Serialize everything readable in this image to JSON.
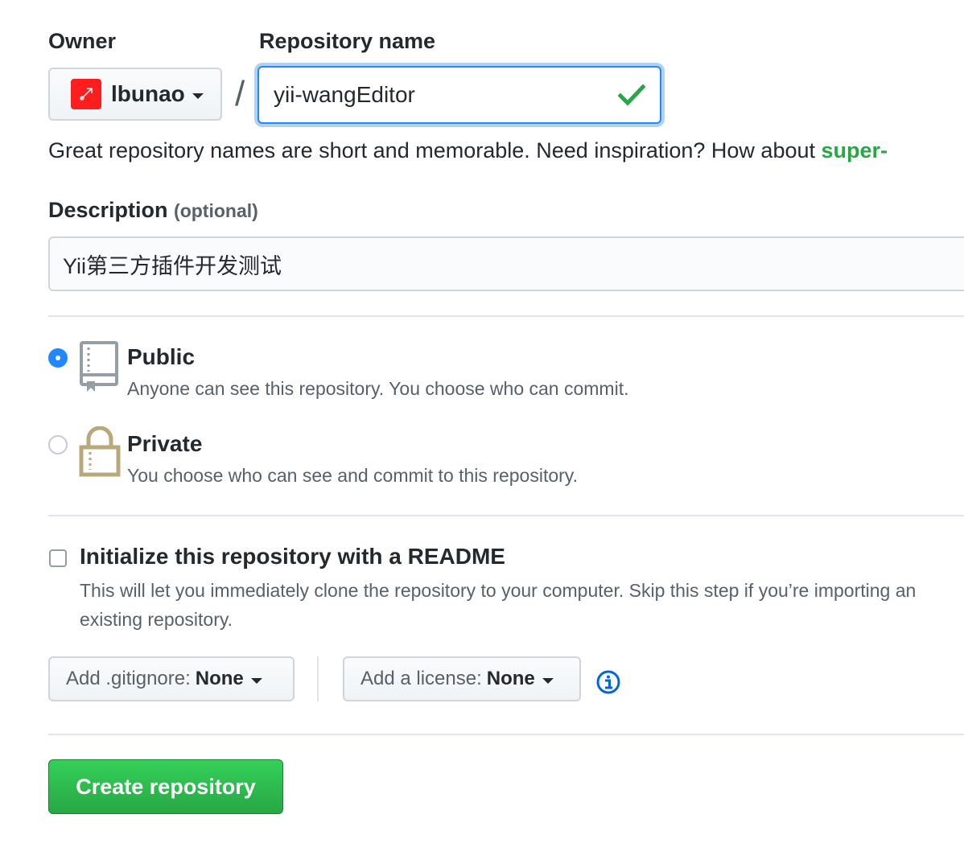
{
  "owner": {
    "label": "Owner",
    "name": "lbunao"
  },
  "separator": "/",
  "repository": {
    "label": "Repository name",
    "value": "yii-wangEditor"
  },
  "hint": {
    "text": "Great repository names are short and memorable. Need inspiration? How about ",
    "suggestion": "super-"
  },
  "description": {
    "label": "Description",
    "optional": "(optional)",
    "value": "Yii第三方插件开发测试"
  },
  "visibility": {
    "public": {
      "title": "Public",
      "desc": "Anyone can see this repository. You choose who can commit.",
      "selected": true
    },
    "private": {
      "title": "Private",
      "desc": "You choose who can see and commit to this repository.",
      "selected": false
    }
  },
  "readme": {
    "title": "Initialize this repository with a README",
    "desc": "This will let you immediately clone the repository to your computer. Skip this step if you’re importing an existing repository.",
    "checked": false
  },
  "gitignore": {
    "prefix": "Add .gitignore:",
    "value": "None"
  },
  "license": {
    "prefix": "Add a license:",
    "value": "None"
  },
  "create_button": "Create repository",
  "colors": {
    "accent": "#2188ff",
    "success": "#28a745",
    "lock": "#b9a87a",
    "repo_icon": "#959da5"
  },
  "icons": [
    "avatar",
    "chevron-down-icon",
    "check-icon",
    "repo-icon",
    "lock-icon",
    "info-icon"
  ]
}
